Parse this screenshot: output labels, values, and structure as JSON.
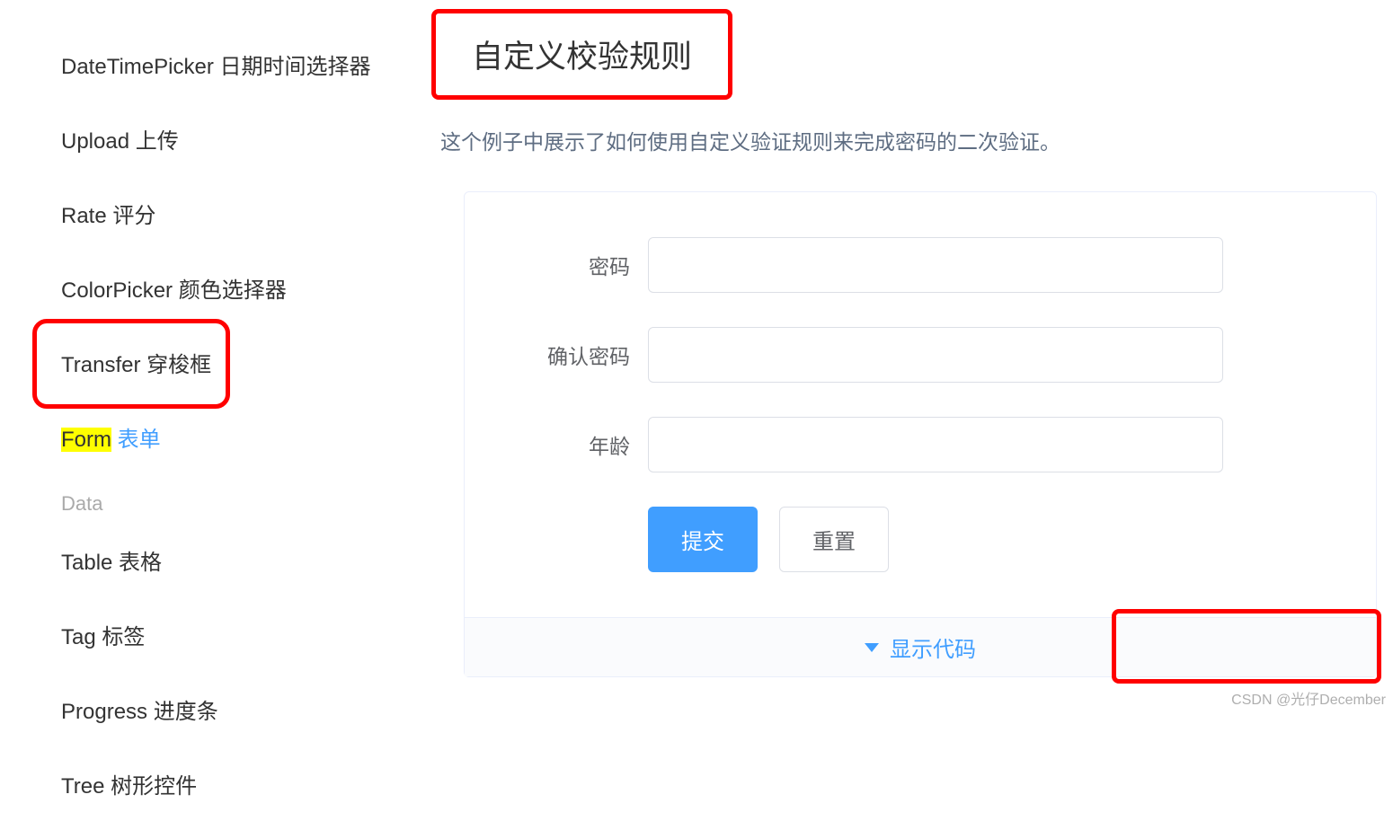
{
  "sidebar": {
    "items": [
      {
        "label": "DateTimePicker 日期时间选择器"
      },
      {
        "label": "Upload 上传"
      },
      {
        "label": "Rate 评分"
      },
      {
        "label": "ColorPicker 颜色选择器"
      },
      {
        "label": "Transfer 穿梭框"
      },
      {
        "label_prefix": "Form",
        "label_suffix": " 表单",
        "active": true
      },
      {
        "label": "Table 表格"
      },
      {
        "label": "Tag 标签"
      },
      {
        "label": "Progress 进度条"
      },
      {
        "label": "Tree 树形控件"
      }
    ],
    "group_label": "Data"
  },
  "main": {
    "title": "自定义校验规则",
    "subtitle": "这个例子中展示了如何使用自定义验证规则来完成密码的二次验证。",
    "form": {
      "password_label": "密码",
      "confirm_label": "确认密码",
      "age_label": "年龄",
      "submit_label": "提交",
      "reset_label": "重置"
    },
    "show_code_label": "显示代码"
  },
  "watermark": "CSDN @光仔December"
}
